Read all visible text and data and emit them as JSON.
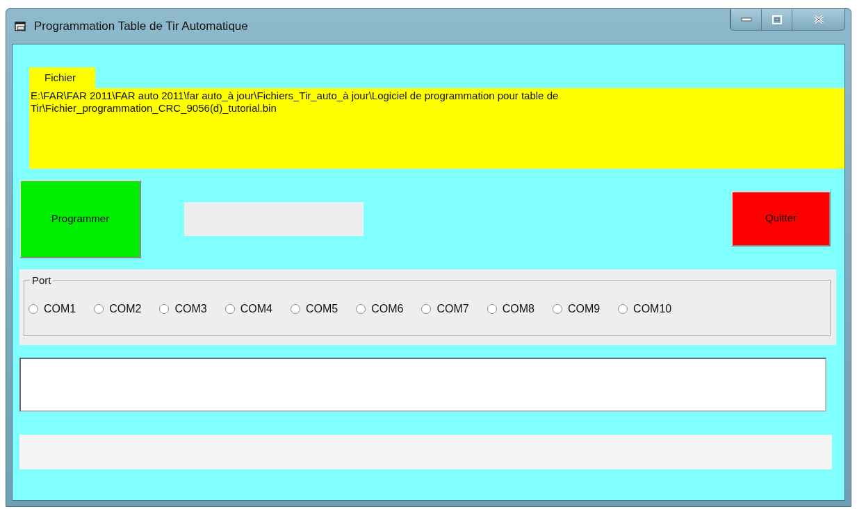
{
  "window": {
    "title": "Programmation Table de Tir Automatique"
  },
  "file": {
    "label": "Fichier",
    "path": "E:\\FAR\\FAR 2011\\FAR auto 2011\\far auto_à jour\\Fichiers_Tir_auto_à jour\\Logiciel de programmation pour table de Tir\\Fichier_programmation_CRC_9056(d)_tutorial.bin"
  },
  "buttons": [
    {
      "label": "Programmer",
      "kind": "go"
    },
    {
      "label": "Quitter",
      "kind": "quit"
    }
  ],
  "port": {
    "label": "Port",
    "options": [
      {
        "label": "COM1",
        "selected": false
      },
      {
        "label": "COM2",
        "selected": false
      },
      {
        "label": "COM3",
        "selected": false
      },
      {
        "label": "COM4",
        "selected": false
      },
      {
        "label": "COM5",
        "selected": false
      },
      {
        "label": "COM6",
        "selected": false
      },
      {
        "label": "COM7",
        "selected": false
      },
      {
        "label": "COM8",
        "selected": false
      },
      {
        "label": "COM9",
        "selected": false
      },
      {
        "label": "COM10",
        "selected": false
      }
    ]
  }
}
